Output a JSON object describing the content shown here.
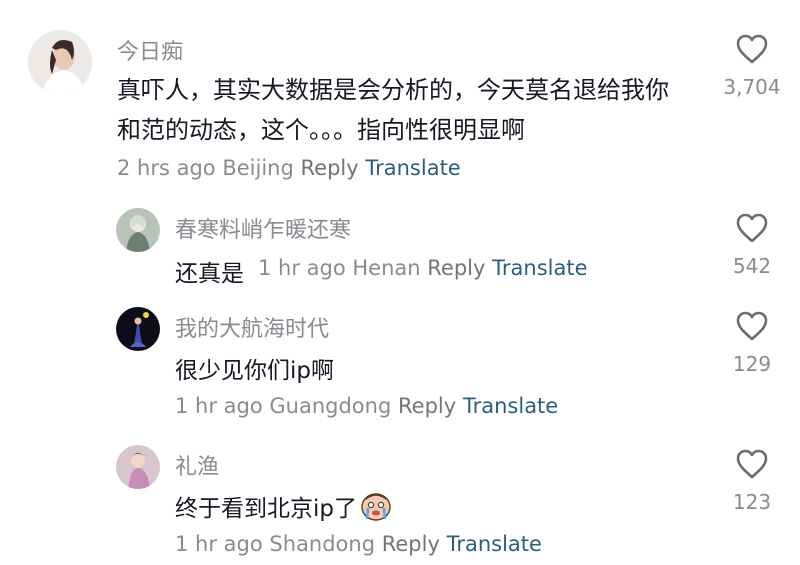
{
  "comments": [
    {
      "username": "今日痴",
      "text_line1": "真吓人，其实大数据是会分析的，今天莫名退给我你",
      "text_line2": "和范的动态，这个。。。指向性很明显啊",
      "time": "2 hrs ago",
      "location": "Beijing",
      "reply_label": "Reply",
      "translate_label": "Translate",
      "likes": "3,704"
    },
    {
      "username": "春寒料峭乍暖还寒",
      "text": "还真是",
      "time": "1 hr ago",
      "location": "Henan",
      "reply_label": "Reply",
      "translate_label": "Translate",
      "likes": "542"
    },
    {
      "username": "我的大航海时代",
      "text": "很少见你们ip啊",
      "time": "1 hr ago",
      "location": "Guangdong",
      "reply_label": "Reply",
      "translate_label": "Translate",
      "likes": "129"
    },
    {
      "username": "礼渔",
      "text": "终于看到北京ip了",
      "emoji": "crying-face-emoji",
      "time": "1 hr ago",
      "location": "Shandong",
      "reply_label": "Reply",
      "translate_label": "Translate",
      "likes": "123"
    }
  ],
  "icons": {
    "like": "heart-outline-icon"
  },
  "colors": {
    "text": "#161823",
    "muted": "#8a8b91",
    "translate": "#2b5f7e"
  }
}
